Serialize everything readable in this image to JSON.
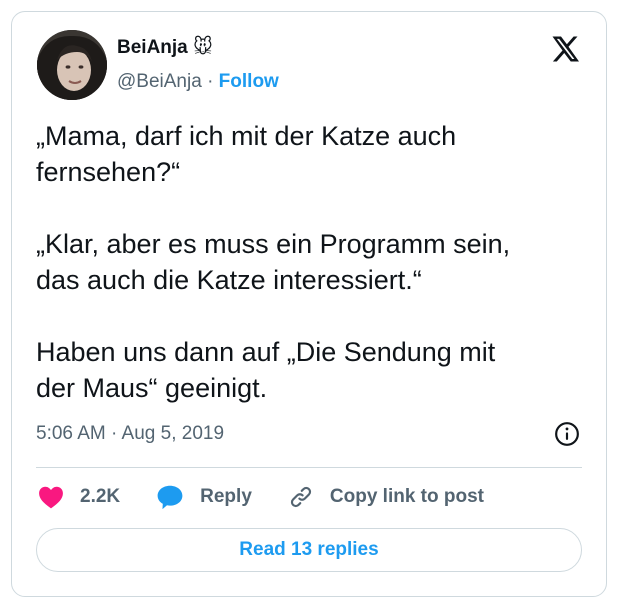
{
  "author": {
    "name": "BeiAnja 🐭",
    "handle": "@BeiAnja",
    "separator": "·",
    "follow_label": "Follow"
  },
  "tweet": {
    "paragraphs": [
      "„Mama, darf ich mit der Katze auch\nfernsehen?“",
      "„Klar, aber es muss ein Programm sein,\ndas auch die Katze interessiert.“",
      "Haben uns dann auf „Die Sendung mit\nder Maus“ geeinigt."
    ],
    "timestamp": "5:06 AM · Aug 5, 2019"
  },
  "actions": {
    "like_count": "2.2K",
    "reply_label": "Reply",
    "copy_label": "Copy link to post"
  },
  "read_replies_label": "Read 13 replies",
  "icons": {
    "logo": "x-logo-icon",
    "info": "info-icon",
    "like": "heart-icon",
    "reply": "speech-bubble-icon",
    "copy": "link-icon"
  },
  "colors": {
    "accent": "#1d9bf0",
    "heart": "#f91880",
    "text": "#0f1419",
    "muted": "#536471",
    "border": "#cfd9de"
  }
}
